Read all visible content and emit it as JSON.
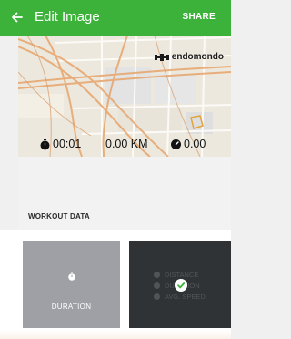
{
  "appbar": {
    "title": "Edit Image",
    "share_label": "SHARE"
  },
  "image": {
    "brand": "endomondo",
    "stats": {
      "duration": "00:01",
      "distance": "0.00 KM",
      "speed": "0.00"
    }
  },
  "workout_data": {
    "title": "WORKOUT DATA",
    "tiles": [
      {
        "label": "DURATION",
        "selected": false
      },
      {
        "items": [
          "DISTANCE",
          "DURATION",
          "AVG. SPEED"
        ],
        "selected": true
      }
    ]
  },
  "colors": {
    "primary": "#3cb23a",
    "tile_gray": "#9ea0a5",
    "tile_dark": "#2f3336",
    "check": "#3cb23a"
  },
  "icons": [
    "back-arrow-icon",
    "endomondo-logo-icon",
    "stopwatch-icon",
    "speed-icon",
    "check-icon"
  ]
}
